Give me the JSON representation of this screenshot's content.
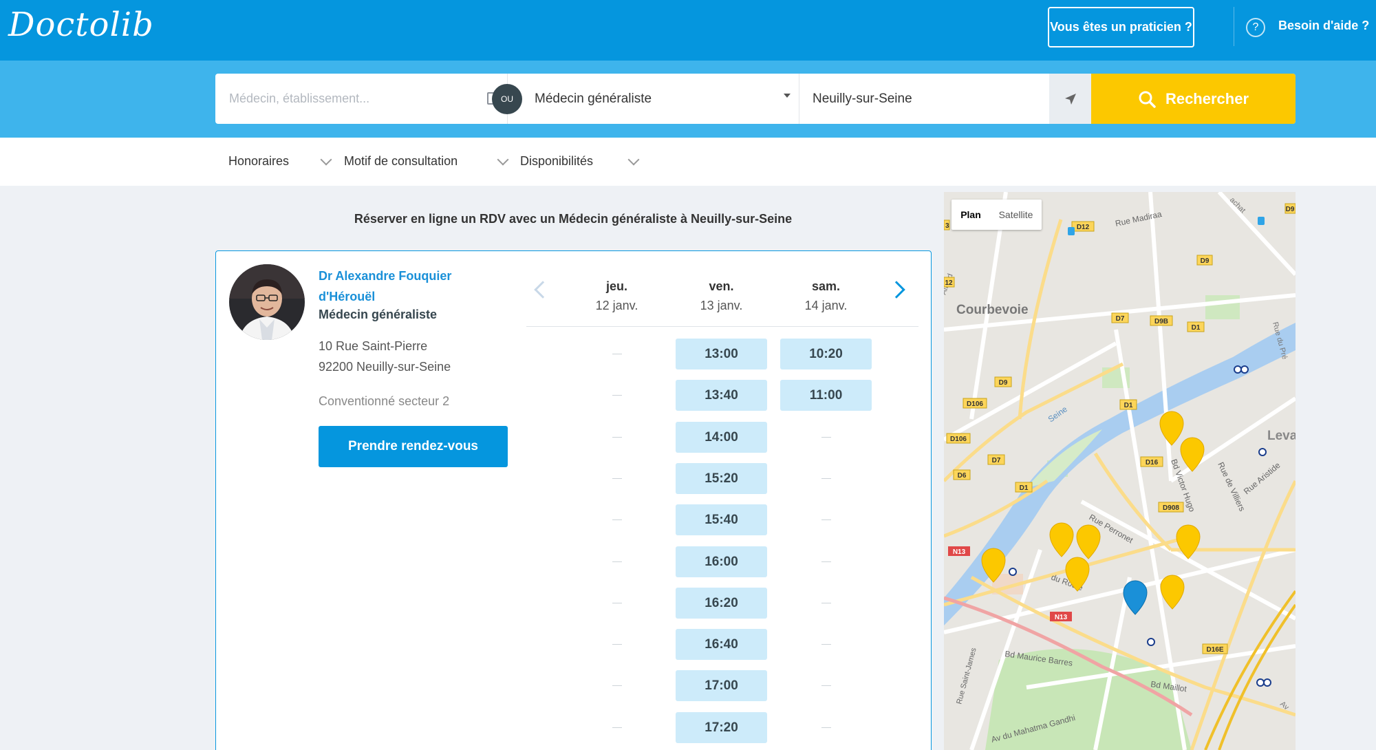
{
  "header": {
    "logo": "Doctolib",
    "pro_button": "Vous êtes un praticien ?",
    "help_icon": "?",
    "help_text": "Besoin d'aide ?"
  },
  "search": {
    "placeholder": "Médecin, établissement...",
    "or_badge": "OU",
    "specialty": "Médecin généraliste",
    "place": "Neuilly-sur-Seine",
    "button": "Rechercher"
  },
  "filters": {
    "fees": "Honoraires",
    "reason": "Motif de consultation",
    "availability": "Disponibilités"
  },
  "results": {
    "title": "Réserver en ligne un RDV avec un Médecin généraliste à Neuilly-sur-Seine"
  },
  "doctor": {
    "name": "Dr Alexandre Fouquier d'Hérouël",
    "specialty": "Médecin généraliste",
    "address_line1": "10 Rue Saint-Pierre",
    "address_line2": "92200 Neuilly-sur-Seine",
    "sector": "Conventionné secteur 2",
    "book_button": "Prendre rendez-vous"
  },
  "calendar": {
    "days": [
      {
        "name": "jeu.",
        "date": "12 janv.",
        "slots": [
          null,
          null,
          null,
          null,
          null,
          null,
          null,
          null,
          null,
          null
        ]
      },
      {
        "name": "ven.",
        "date": "13 janv.",
        "slots": [
          "13:00",
          "13:40",
          "14:00",
          "15:20",
          "15:40",
          "16:00",
          "16:20",
          "16:40",
          "17:00",
          "17:20"
        ]
      },
      {
        "name": "sam.",
        "date": "14 janv.",
        "slots": [
          "10:20",
          "11:00",
          null,
          null,
          null,
          null,
          null,
          null,
          null,
          null
        ]
      }
    ],
    "empty_marker": "—"
  },
  "map": {
    "type_plan": "Plan",
    "type_satellite": "Satellite",
    "labels": {
      "courbevoie": "Courbevoie",
      "seine": "Seine",
      "levallois": "Leva",
      "rue_madiraa": "Rue Madiraa",
      "rue_peronnet": "Rue Perronet",
      "du_roule": "du Roule",
      "bd_victor_hugo": "Bd Victor Hugo",
      "rue_de_villiers": "Rue de Villiers",
      "rue_aristide": "Rue Aristide",
      "bd_maurice_barres": "Bd Maurice Barres",
      "bd_maillot": "Bd Maillot",
      "av_mahatma_gandhi": "Av du Mahatma Gandhi",
      "rue_saint_james": "Rue Saint-James",
      "alfford": "Alfford",
      "achat": "achat",
      "rue_du_pre": "Rue du Pré",
      "av": "Av"
    },
    "road_badges": {
      "d12": "D12",
      "d9": "D9",
      "d7": "D7",
      "d9b": "D9B",
      "d1": "D1",
      "d106": "D106",
      "d6": "D6",
      "d16": "D16",
      "d908": "D908",
      "n13": "N13",
      "d16e": "D16E",
      "d12b": "12",
      "d9r": "D9",
      "d3": "3"
    },
    "colors": {
      "pin_other": "#fcc800",
      "pin_selected": "#1a90d8"
    }
  },
  "colors": {
    "brand": "#0596de",
    "band": "#3eb4ec",
    "search_button": "#fcc800",
    "slot": "#cdebfa"
  }
}
